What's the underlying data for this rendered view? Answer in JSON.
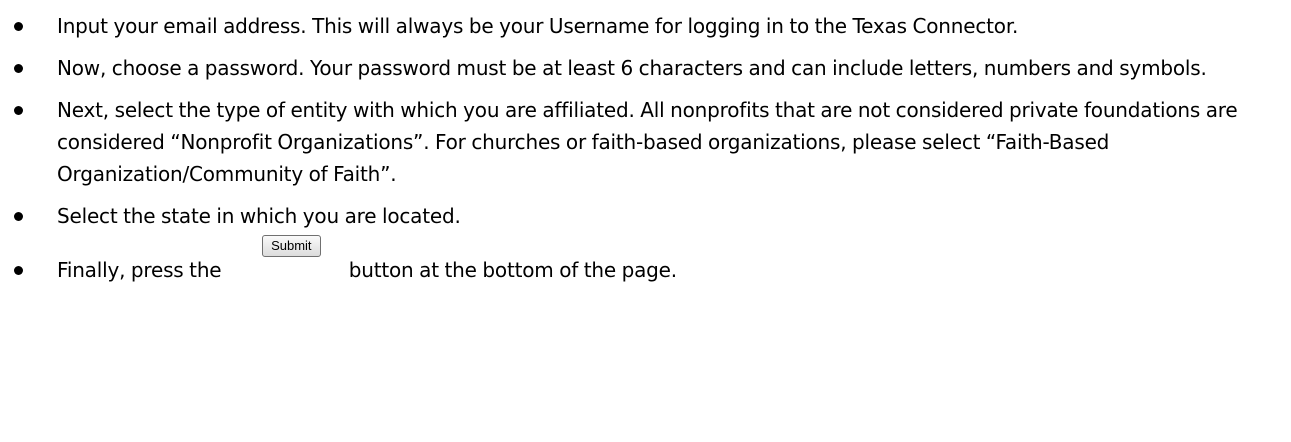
{
  "instructions": [
    {
      "text": "Input your email address.  This will always be your Username for logging in to the Texas Connector."
    },
    {
      "text": "Now, choose a password.  Your password must be at least 6 characters and can include letters, numbers and symbols."
    },
    {
      "text": "Next, select the type of entity with which you are affiliated.  All nonprofits that are not considered private foundations are considered “Nonprofit Organizations”.  For churches or faith-based organizations, please select “Faith-Based Organization/Community of Faith”."
    },
    {
      "text": "Select the state in which you are located."
    },
    {
      "text_before": "Finally, press the",
      "button_label": "Submit",
      "text_after": "button at the bottom of the page."
    }
  ]
}
